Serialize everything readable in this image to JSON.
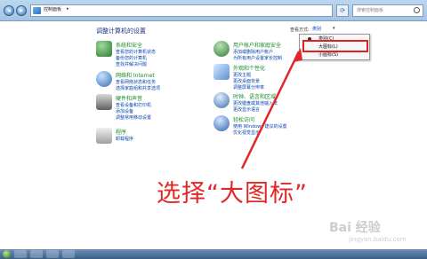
{
  "window": {
    "address_text": "控制面板",
    "address_sep": "▸",
    "search_placeholder": "搜索控制面板",
    "refresh_icon": "refresh-icon"
  },
  "main": {
    "title": "调整计算机的设置",
    "view_by_label": "查看方式:",
    "view_by_value": "类别",
    "view_by_caret": "▾"
  },
  "categories_left": [
    {
      "title": "系统和安全",
      "links": [
        "查看您的计算机状态",
        "备份您的计算机",
        "查找并解决问题"
      ],
      "color": "#2f7d32"
    },
    {
      "title": "网络和 Internet",
      "links": [
        "查看网络状态和任务",
        "选择家庭组和共享选项"
      ],
      "color": "#3a6fb0"
    },
    {
      "title": "硬件和声音",
      "links": [
        "查看设备和打印机",
        "添加设备",
        "调整常用移动设置"
      ],
      "color": "#606060"
    },
    {
      "title": "程序",
      "links": [
        "卸载程序"
      ],
      "color": "#a0a0a0"
    }
  ],
  "categories_right": [
    {
      "title": "用户帐户和家庭安全",
      "links": [
        "添加或删除用户帐户",
        "为所有用户设置家长控制"
      ],
      "color": "#3a7b3a"
    },
    {
      "title": "外观和个性化",
      "links": [
        "更改主题",
        "更改桌面背景",
        "调整屏幕分辨率"
      ],
      "color": "#5a8fd0"
    },
    {
      "title": "时钟、语言和区域",
      "links": [
        "更改键盘或其他输入法",
        "更改显示语言"
      ],
      "color": "#3d6fa8"
    },
    {
      "title": "轻松访问",
      "links": [
        "使用 Windows 建议的设置",
        "优化视觉显示"
      ],
      "color": "#2e63b0"
    }
  ],
  "menu": {
    "items": [
      "类别(C)",
      "大图标(L)",
      "小图标(S)"
    ],
    "selected_index": 0,
    "highlighted_index": 1
  },
  "annotation": {
    "caption": "选择“大图标”",
    "color": "#e02828"
  },
  "watermark": {
    "brand": "Bai 经验",
    "sub": "jingyan.baidu.com"
  }
}
